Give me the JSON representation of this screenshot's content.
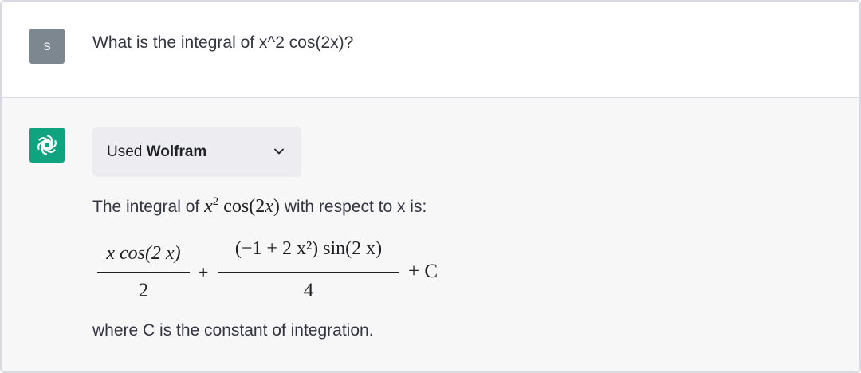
{
  "user_message": {
    "avatar_initial": "S",
    "text": "What is the integral of x^2 cos(2x)?"
  },
  "assistant_message": {
    "avatar_icon": "openai-logo-icon",
    "tool": {
      "prefix": "Used",
      "name": "Wolfram",
      "toggle_icon": "chevron-down-icon"
    },
    "intro_before": "The integral of",
    "intro_expr": {
      "base": "x",
      "exp": "2",
      "func": "cos(2",
      "var": "x",
      "close": ")"
    },
    "intro_after": "with respect to x is:",
    "formula": {
      "term1_num": "x cos(2 x)",
      "term1_den": "2",
      "plus1": "+",
      "term2_num": "(−1 + 2 x²) sin(2 x)",
      "term2_den": "4",
      "plus2": "+ C"
    },
    "outro": "where C is the constant of integration."
  },
  "colors": {
    "user_avatar": "#7d8790",
    "assistant_avatar": "#10a37f",
    "assistant_bg": "#f7f7f8",
    "tool_pill_bg": "#ececf1"
  }
}
